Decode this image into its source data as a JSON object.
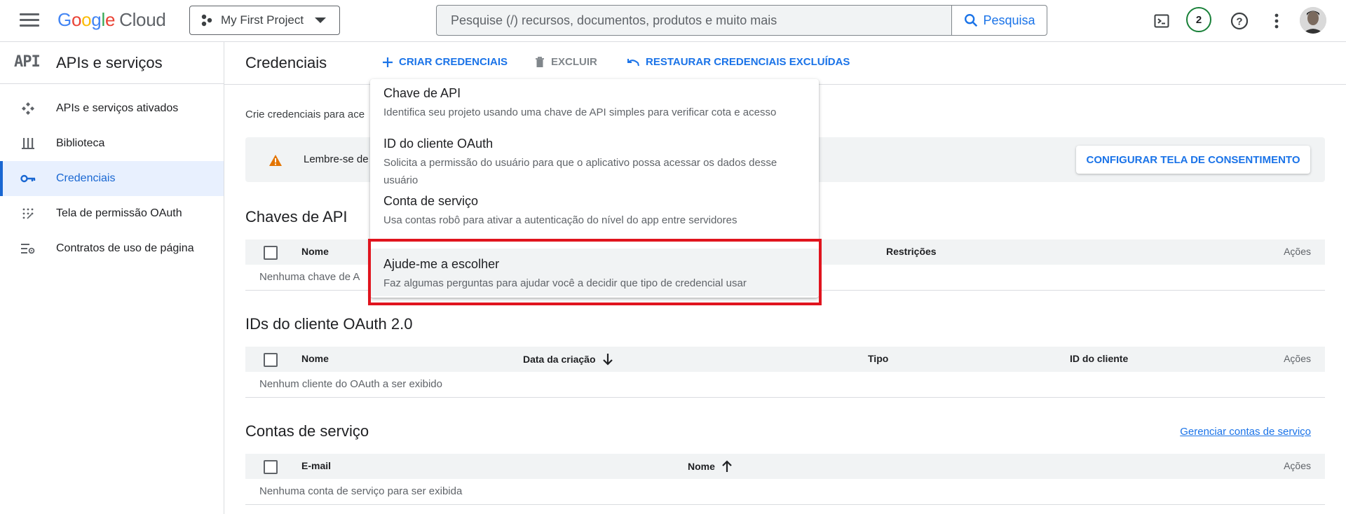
{
  "header": {
    "logo_google": [
      "G",
      "o",
      "o",
      "g",
      "l",
      "e"
    ],
    "logo_cloud": "Cloud",
    "project_name": "My First Project",
    "search_placeholder": "Pesquise (/) recursos, documentos, produtos e muito mais",
    "search_button": "Pesquisa",
    "notification_count": "2"
  },
  "sidebar": {
    "api_logo": "API",
    "title": "APIs e serviços",
    "items": [
      {
        "label": "APIs e serviços ativados",
        "icon": "apis-icon",
        "active": false
      },
      {
        "label": "Biblioteca",
        "icon": "library-icon",
        "active": false
      },
      {
        "label": "Credenciais",
        "icon": "key-icon",
        "active": true
      },
      {
        "label": "Tela de permissão OAuth",
        "icon": "oauth-consent-icon",
        "active": false
      },
      {
        "label": "Contratos de uso de página",
        "icon": "page-agreements-icon",
        "active": false
      }
    ]
  },
  "main": {
    "title": "Credenciais",
    "toolbar": {
      "create": "CRIAR CREDENCIAIS",
      "delete": "EXCLUIR",
      "restore": "RESTAURAR CREDENCIAIS EXCLUÍDAS"
    },
    "intro_text": "Crie credenciais para ace",
    "banner_text": "Lembre-se de",
    "consent_button": "CONFIGURAR TELA DE CONSENTIMENTO",
    "api_keys": {
      "title": "Chaves de API",
      "col_name": "Nome",
      "col_restrictions": "Restrições",
      "col_actions": "Ações",
      "empty": "Nenhuma chave de A"
    },
    "oauth": {
      "title": "IDs do cliente OAuth 2.0",
      "col_name": "Nome",
      "col_created": "Data da criação",
      "col_type": "Tipo",
      "col_client_id": "ID do cliente",
      "col_actions": "Ações",
      "empty": "Nenhum cliente do OAuth a ser exibido"
    },
    "service_accounts": {
      "title": "Contas de serviço",
      "manage_link": "Gerenciar contas de serviço",
      "col_email": "E-mail",
      "col_name": "Nome",
      "col_actions": "Ações",
      "empty": "Nenhuma conta de serviço para ser exibida"
    }
  },
  "dropdown": {
    "items": [
      {
        "title": "Chave de API",
        "desc": "Identifica seu projeto usando uma chave de API simples para verificar cota e acesso"
      },
      {
        "title": "ID do cliente OAuth",
        "desc": "Solicita a permissão do usuário para que o aplicativo possa acessar os dados desse usuário"
      },
      {
        "title": "Conta de serviço",
        "desc": "Usa contas robô para ativar a autenticação do nível do app entre servidores"
      },
      {
        "title": "Ajude-me a escolher",
        "desc": "Faz algumas perguntas para ajudar você a decidir que tipo de credencial usar"
      }
    ]
  },
  "colors": {
    "accent_blue": "#1a73e8",
    "highlight_red": "#e0141e",
    "warning_orange": "#e37400",
    "notification_green": "#188038"
  }
}
